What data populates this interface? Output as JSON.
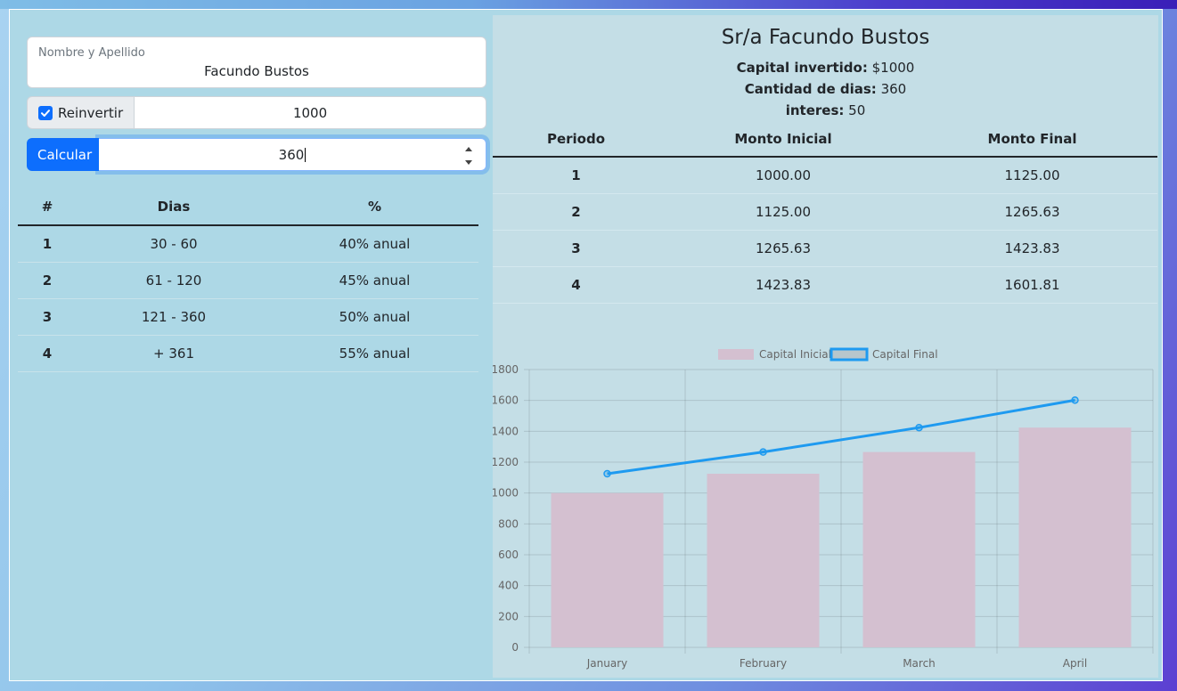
{
  "form": {
    "name_label": "Nombre y Apellido",
    "name_value": "Facundo Bustos",
    "reinvest_label": "Reinvertir",
    "reinvest_checked": true,
    "capital_value": "1000",
    "calc_button": "Calcular",
    "days_value": "360"
  },
  "rates_table": {
    "headers": [
      "#",
      "Dias",
      "%"
    ],
    "rows": [
      [
        "1",
        "30 - 60",
        "40% anual"
      ],
      [
        "2",
        "61 - 120",
        "45% anual"
      ],
      [
        "3",
        "121 - 360",
        "50% anual"
      ],
      [
        "4",
        "+ 361",
        "55% anual"
      ]
    ]
  },
  "result": {
    "title": "Sr/a Facundo Bustos",
    "capital_label": "Capital invertido:",
    "capital_value": "$1000",
    "days_label": "Cantidad de dias:",
    "days_value": "360",
    "interest_label": "interes:",
    "interest_value": "50"
  },
  "periods_table": {
    "headers": [
      "Periodo",
      "Monto Inicial",
      "Monto Final"
    ],
    "rows": [
      [
        "1",
        "1000.00",
        "1125.00"
      ],
      [
        "2",
        "1125.00",
        "1265.63"
      ],
      [
        "3",
        "1265.63",
        "1423.83"
      ],
      [
        "4",
        "1423.83",
        "1601.81"
      ]
    ]
  },
  "chart_data": {
    "type": "bar",
    "categories": [
      "January",
      "February",
      "March",
      "April"
    ],
    "series": [
      {
        "name": "Capital Inicial",
        "type": "bar",
        "color": "#d4c0d0",
        "values": [
          1000,
          1125,
          1265.63,
          1423.83
        ]
      },
      {
        "name": "Capital Final",
        "type": "line",
        "color": "#1e9af0",
        "values": [
          1125,
          1265.63,
          1423.83,
          1601.81
        ]
      }
    ],
    "ylim": [
      0,
      1800
    ],
    "yticks": [
      "0",
      "200",
      "400",
      "600",
      "800",
      "1000",
      "1200",
      "1400",
      "1600",
      "1800"
    ],
    "grid": true,
    "legend": "top"
  },
  "colors": {
    "primary": "#0d6efd",
    "panel_bg": "#add8e6",
    "right_bg": "#c4dee6"
  }
}
